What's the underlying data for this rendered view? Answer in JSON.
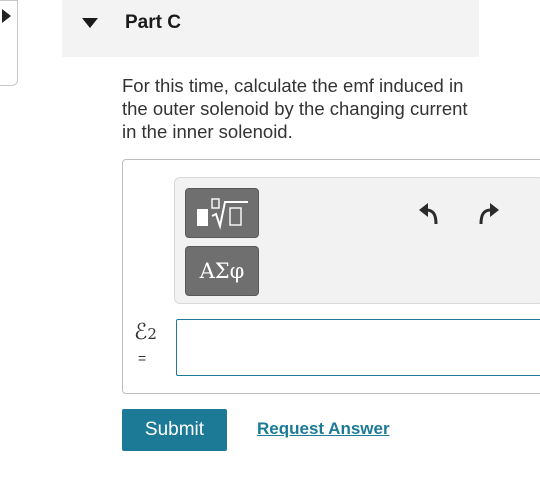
{
  "part": {
    "title": "Part C"
  },
  "question": {
    "text": "For this time, calculate the emf induced in the outer solenoid by the changing current in the inner solenoid."
  },
  "toolbar": {
    "templates_icon": "templates-sqrt-icon",
    "symbols_label": "ΑΣφ",
    "undo_icon": "undo-icon",
    "redo_icon": "redo-icon"
  },
  "answer": {
    "variable_symbol": "ℰ",
    "variable_subscript": "2",
    "equals": "=",
    "value": ""
  },
  "actions": {
    "submit_label": "Submit",
    "request_answer_label": "Request Answer"
  },
  "colors": {
    "accent": "#1c7a97",
    "button_gray": "#6f6f6f"
  }
}
